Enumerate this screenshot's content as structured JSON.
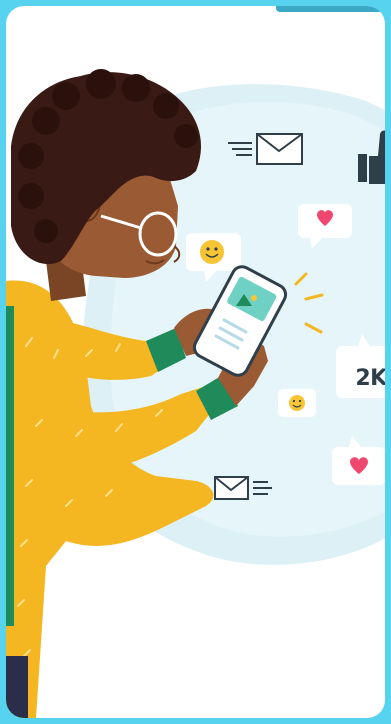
{
  "illustration": {
    "notification_count": "2K",
    "palette": {
      "frame": "#57d3ef",
      "glow": "#dcf0f6",
      "sweater": "#f4b722",
      "cuff": "#1f8a5a",
      "skin": "#9a5a33",
      "hair": "#3a1a14",
      "heart": "#ef476f",
      "emoji": "#f7c433",
      "ink": "#2e3f4a"
    },
    "icons": [
      "envelope-icon",
      "thumbs-up-icon",
      "heart-icon",
      "smiley-icon",
      "photo-icon"
    ]
  }
}
